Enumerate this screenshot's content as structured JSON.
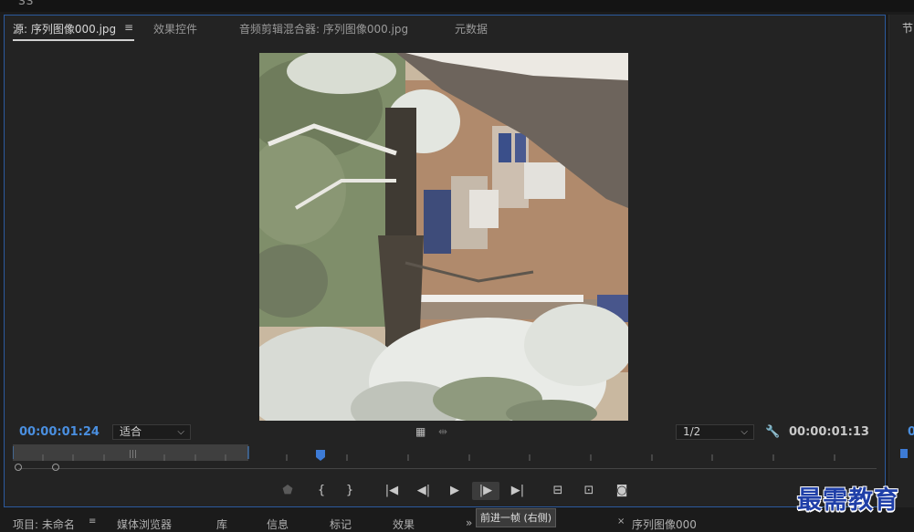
{
  "app": {
    "top_glyph": "SS"
  },
  "source_panel": {
    "tabs": [
      {
        "label": "源: 序列图像000.jpg",
        "active": true
      },
      {
        "label": "效果控件",
        "active": false
      },
      {
        "label": "音频剪辑混合器: 序列图像000.jpg",
        "active": false
      },
      {
        "label": "元数据",
        "active": false
      }
    ],
    "menu_icon": "hamburger-icon",
    "playhead_timecode": "00:00:01:24",
    "zoom_select": "适合",
    "resolution_select": "1/2",
    "duration_timecode": "00:00:01:13",
    "settings_icon": "wrench-icon",
    "transport": [
      {
        "name": "add-marker-button",
        "icon": "marker-icon",
        "glyph": "⬟"
      },
      {
        "name": "mark-in-button",
        "icon": "mark-in-icon",
        "glyph": "{"
      },
      {
        "name": "mark-out-button",
        "icon": "mark-out-icon",
        "glyph": "}"
      },
      {
        "name": "go-to-in-button",
        "icon": "go-to-in-icon",
        "glyph": "|◀"
      },
      {
        "name": "step-back-button",
        "icon": "step-back-icon",
        "glyph": "◀|"
      },
      {
        "name": "play-button",
        "icon": "play-icon",
        "glyph": "▶"
      },
      {
        "name": "step-forward-button",
        "icon": "step-forward-icon",
        "glyph": "|▶"
      },
      {
        "name": "go-to-out-button",
        "icon": "go-to-out-icon",
        "glyph": "▶|"
      },
      {
        "name": "insert-button",
        "icon": "insert-icon",
        "glyph": "⊟"
      },
      {
        "name": "overwrite-button",
        "icon": "overwrite-icon",
        "glyph": "⊡"
      },
      {
        "name": "export-frame-button",
        "icon": "camera-icon",
        "glyph": "◙"
      }
    ],
    "tooltip": "前进一帧 (右侧)"
  },
  "bottom_tabs": [
    "项目: 未命名",
    "媒体浏览器",
    "库",
    "信息",
    "标记",
    "效果",
    "»",
    "序列图像000"
  ],
  "right_panel": {
    "tab_label": "节"
  },
  "watermark": "最需教育",
  "colors": {
    "accent_blue": "#4a8fe0",
    "panel_border": "#2b5a9e",
    "panel_bg": "#232323"
  }
}
